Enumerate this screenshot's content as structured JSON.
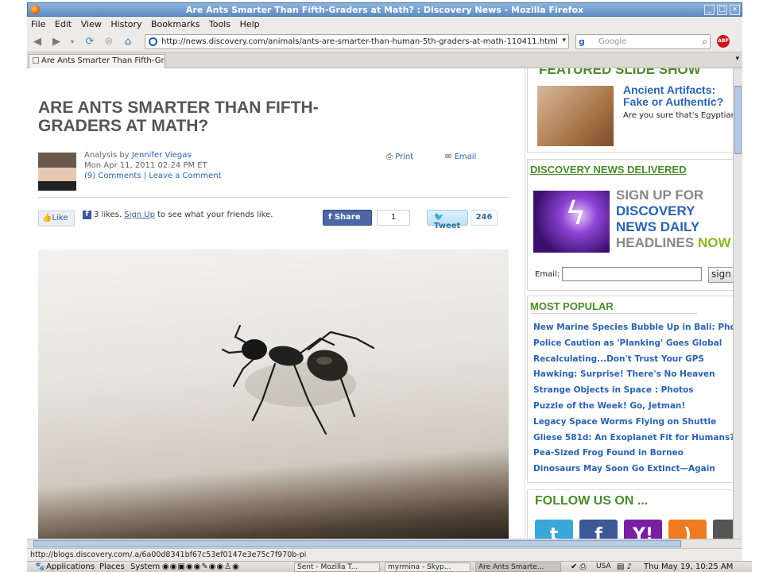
{
  "window": {
    "title": "Are Ants Smarter Than Fifth-Graders at Math? : Discovery News - Mozilla Firefox"
  },
  "menu": [
    "File",
    "Edit",
    "View",
    "History",
    "Bookmarks",
    "Tools",
    "Help"
  ],
  "nav": {
    "url": "http://news.discovery.com/animals/ants-are-smarter-than-human-5th-graders-at-math-110411.html",
    "search_placeholder": "Google",
    "adblock_label": "ABP"
  },
  "tab": {
    "label": "Are Ants Smarter Than Fifth-Gr..."
  },
  "article": {
    "title": "ARE ANTS SMARTER THAN FIFTH-GRADERS AT MATH?",
    "byline_prefix": "Analysis by",
    "author": "Jennifer Viegas",
    "date": "Mon Apr 11, 2011 02:24 PM ET",
    "comments": "(9) Comments",
    "separator": "|",
    "leave_comment": "Leave a Comment",
    "print": "Print",
    "email": "Email",
    "like_button": "Like",
    "like_count_text": "3 likes.",
    "like_signup": "Sign Up",
    "like_suffix": "to see what your friends like.",
    "share_button": "Share",
    "share_count": "1",
    "tweet_button": "Tweet",
    "tweet_count": "246"
  },
  "sidebar": {
    "featured_title": "FEATURED SLIDE SHOW",
    "featured_headline": "Ancient Artifacts: Fake or Authentic?",
    "featured_desc": "Are you sure that's Egyptian?",
    "delivered_title": "DISCOVERY NEWS DELIVERED",
    "signup_line1": "SIGN UP FOR",
    "signup_line2": "DISCOVERY",
    "signup_line3": "NEWS DAILY",
    "signup_line4a": "HEADLINES",
    "signup_line4b": "NOW",
    "email_label": "Email:",
    "signup_button": "sign",
    "most_popular_title": "MOST POPULAR",
    "most_popular": [
      "New Marine Species Bubble Up in Bali: Photos",
      "Police Caution as 'Planking' Goes Global",
      "Recalculating...Don't Trust Your GPS",
      "Hawking: Surprise! There's No Heaven",
      "Strange Objects in Space : Photos",
      "Puzzle of the Week! Go, Jetman!",
      "Legacy Space Worms Flying on Shuttle",
      "Gliese 581d: An Exoplanet Fit for Humans?",
      "Pea-Sized Frog Found in Borneo",
      "Dinosaurs May Soon Go Extinct—Again"
    ],
    "follow_title": "FOLLOW US ON ...",
    "social": [
      {
        "name": "twitter",
        "glyph": "t",
        "color": "#3aa7d8"
      },
      {
        "name": "facebook",
        "glyph": "f",
        "color": "#3b5998"
      },
      {
        "name": "yahoo",
        "glyph": "Y!",
        "color": "#7b1fa2"
      },
      {
        "name": "rss",
        "glyph": ")",
        "color": "#ee7b22"
      },
      {
        "name": "more",
        "glyph": "",
        "color": "#555555"
      }
    ]
  },
  "status": {
    "text": "http://blogs.discovery.com/.a/6a00d8341bf67c53ef0147e3e75c7f970b-pi"
  },
  "taskbar": {
    "applications": "Applications",
    "places": "Places",
    "system": "System",
    "tasks": [
      "Sent - Mozilla T...",
      "myrmina - Skyp...",
      "Are Ants Smarte..."
    ],
    "locale": "USA",
    "clock": "Thu May 19, 10:25 AM"
  }
}
